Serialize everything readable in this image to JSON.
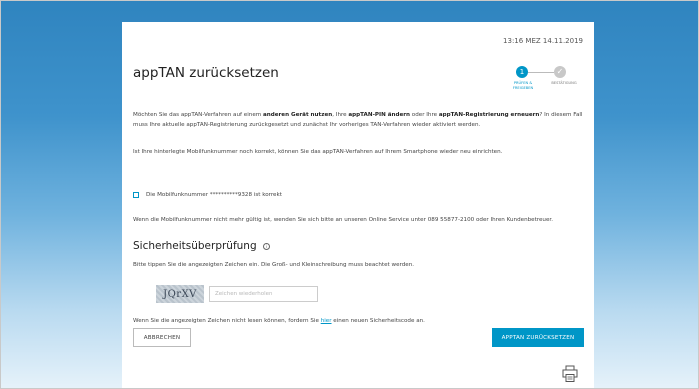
{
  "timestamp": "13:16 MEZ 14.11.2019",
  "title": "appTAN zurücksetzen",
  "stepper": {
    "step1_number": "1",
    "step1_label": "PRÜFEN & FREIGEBEN",
    "step2_label": "BESTÄTIGUNG",
    "step2_symbol": "✓"
  },
  "intro": {
    "t1": "Möchten Sie das appTAN-Verfahren auf einem ",
    "b1": "anderen Gerät nutzen",
    "t2": ", Ihre ",
    "b2": "appTAN-PIN ändern",
    "t3": " oder Ihre ",
    "b3": "appTAN-Registrierung erneuern",
    "t4": "? In diesem Fall muss Ihre aktuelle appTAN-Registrierung zurückgesetzt und zunächst Ihr vorheriges TAN-Verfahren wieder aktiviert werden."
  },
  "phone_question": "Ist Ihre hinterlegte Mobilfunknummer noch korrekt, können Sie das appTAN-Verfahren auf Ihrem Smartphone wieder neu einrichten.",
  "checkbox_label": "Die Mobilfunknummer **********9328 ist korrekt",
  "phone_invalid_text": "Wenn die Mobilfunknummer nicht mehr gültig ist, wenden Sie sich bitte an unseren Online Service unter 089 55877-2100 oder Ihren Kundenbetreuer.",
  "security": {
    "heading": "Sicherheitsüberprüfung",
    "info_symbol": "i",
    "instructions": "Bitte tippen Sie die angezeigten Zeichen ein. Die Groß- und Kleinschreibung muss beachtet werden.",
    "captcha_text": "JQrXV",
    "input_placeholder": "Zeichen wiederholen",
    "input_value": "",
    "cant_read_pre": "Wenn Sie die angezeigten Zeichen nicht lesen können, fordern Sie ",
    "cant_read_link": "hier",
    "cant_read_post": " einen neuen Sicherheitscode an."
  },
  "buttons": {
    "cancel": "ABBRECHEN",
    "reset": "APPTAN ZURÜCKSETZEN"
  },
  "icons": {
    "print": "printer-icon"
  },
  "colors": {
    "accent": "#0096c7",
    "inactive": "#c8c8c8"
  }
}
